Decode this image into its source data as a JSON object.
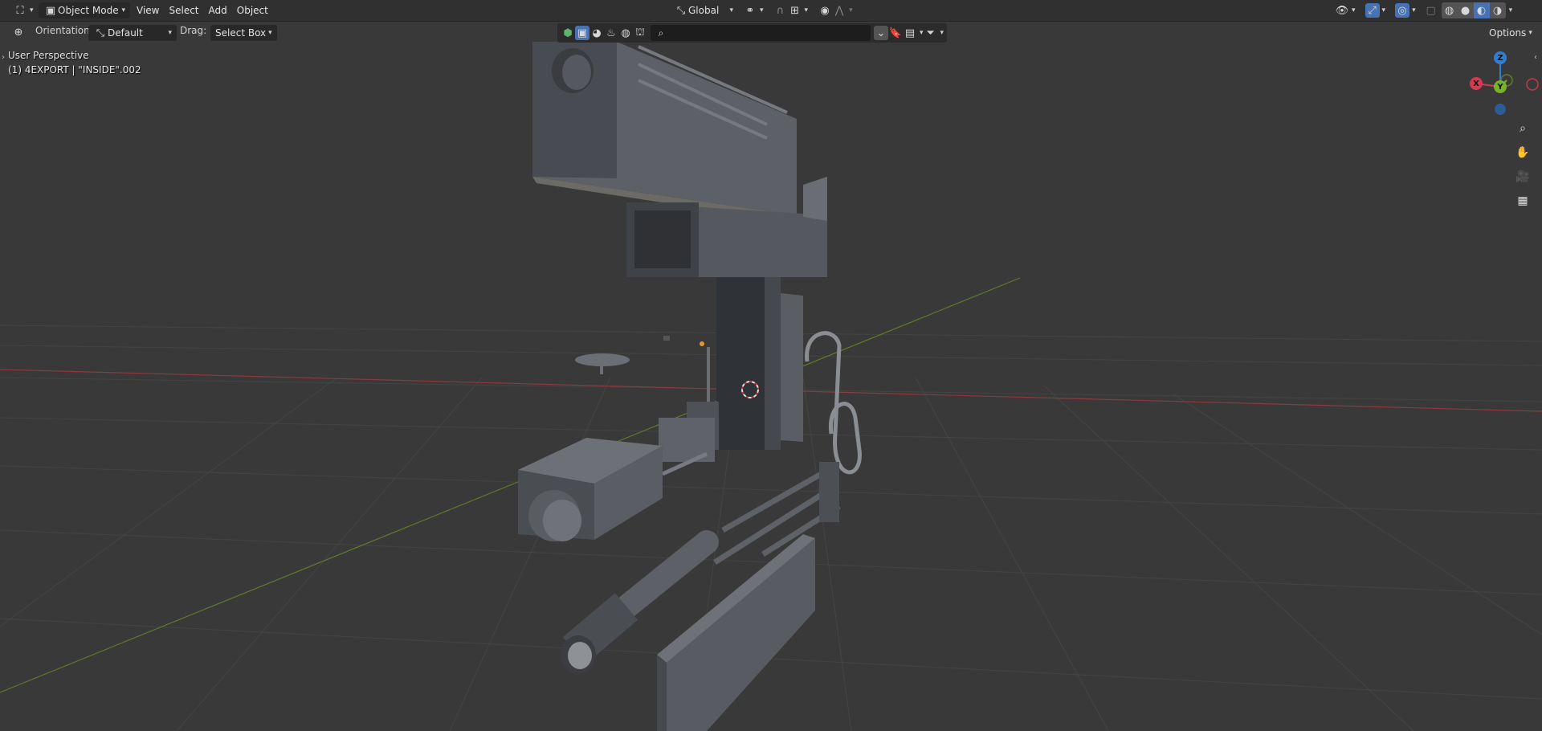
{
  "header": {
    "editor_type_icon": "3d-viewport-icon",
    "mode": {
      "icon": "object-mode-icon",
      "label": "Object Mode"
    },
    "menus": [
      "View",
      "Select",
      "Add",
      "Object"
    ],
    "transform_orientation": {
      "icon": "global-axes-icon",
      "label": "Global"
    },
    "pivot_icon": "pivot-link-icon",
    "snap_icons": [
      "snap-magnet-icon",
      "snap-increment-icon"
    ],
    "proportional_icons": [
      "proportional-edit-icon",
      "falloff-curve-icon"
    ],
    "right_icons": [
      "visibility-eye-icon",
      "gizmo-toggle-icon",
      "overlay-toggle-icon",
      "xray-toggle-icon"
    ],
    "shading_modes": [
      "wireframe-shading-icon",
      "solid-shading-icon",
      "material-shading-icon",
      "rendered-shading-icon"
    ],
    "active_shading": 2
  },
  "toolbar": {
    "tool_icon": "transform-tool-icon",
    "orientation_label": "Orientation:",
    "orientation_value": "Default",
    "drag_label": "Drag:",
    "drag_value": "Select Box",
    "options_label": "Options"
  },
  "outliner_filter": {
    "icons": [
      "scene-collection-icon",
      "object-filter-icon",
      "sphere-icon",
      "lights-icon",
      "world-icon",
      "camera-filter-icon"
    ],
    "search_value": "",
    "search_placeholder": "",
    "right_icons": [
      "collapse-icon",
      "bookmark-icon",
      "display-mode-icon",
      "filter-icon"
    ]
  },
  "viewport": {
    "perspective_label": "User Perspective",
    "object_label": "(1) 4EXPORT | \"INSIDE\".002"
  },
  "gizmo": {
    "axes": [
      {
        "label": "Z",
        "color": "#2f7fd6"
      },
      {
        "label": "X",
        "color": "#d63a4f"
      },
      {
        "label": "Y",
        "color": "#7ab12b"
      }
    ],
    "nav_icons": [
      "zoom-icon",
      "pan-hand-icon",
      "camera-view-icon",
      "ortho-grid-icon"
    ]
  },
  "colors": {
    "header_bg": "#303030",
    "viewport_bg": "#393939",
    "grid_line": "#424242",
    "x_axis_line": "#8c3a3f",
    "y_axis_line": "#5f7a2a",
    "accent": "#4772b3"
  }
}
